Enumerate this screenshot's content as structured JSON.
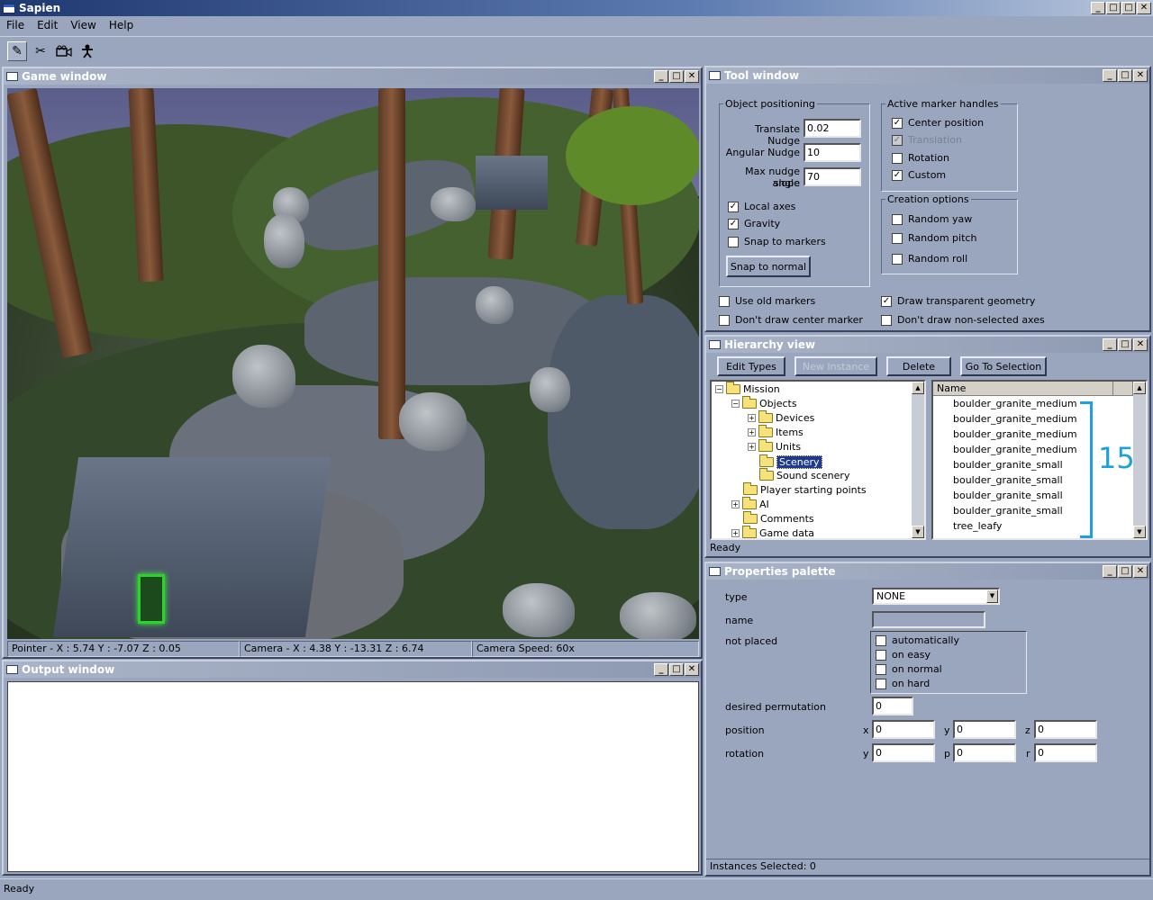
{
  "app": {
    "title": "Sapien"
  },
  "menu": [
    "File",
    "Edit",
    "View",
    "Help"
  ],
  "toolbar": {
    "icons": [
      "pencil-icon",
      "scissors-icon",
      "camera-icon",
      "player-icon"
    ]
  },
  "window_buttons": {
    "minimize": "_",
    "restore": "□",
    "close": "✕"
  },
  "game_window": {
    "title": "Game window",
    "status": {
      "pointer": "Pointer - X : 5.74  Y : -7.07  Z : 0.05",
      "camera": "Camera - X : 4.38  Y : -13.31  Z : 6.74",
      "speed": "Camera Speed: 60x"
    }
  },
  "output_window": {
    "title": "Output window"
  },
  "tool_window": {
    "title": "Tool window",
    "object_positioning": {
      "legend": "Object positioning",
      "translate_label": "Translate Nudge",
      "translate_value": "0.02",
      "angular_label": "Angular Nudge",
      "angular_value": "10",
      "slope_label_1": "Max nudge slope",
      "slope_label_2": "angle",
      "slope_value": "70",
      "local_axes": "Local axes",
      "gravity": "Gravity",
      "snap_markers": "Snap to markers",
      "snap_normal": "Snap to normal"
    },
    "active_marker_handles": {
      "legend": "Active marker handles",
      "center": "Center position",
      "translation": "Translation",
      "rotation": "Rotation",
      "custom": "Custom"
    },
    "creation_options": {
      "legend": "Creation options",
      "yaw": "Random yaw",
      "pitch": "Random pitch",
      "roll": "Random roll"
    },
    "use_old_markers": "Use old markers",
    "dont_draw_center": "Don't draw center marker",
    "draw_transparent": "Draw transparent geometry",
    "dont_draw_axes": "Don't draw non-selected axes"
  },
  "hierarchy": {
    "title": "Hierarchy view",
    "buttons": {
      "edit_types": "Edit Types",
      "new_instance": "New Instance",
      "delete": "Delete",
      "go_to_selection": "Go To Selection"
    },
    "tree": [
      "Mission",
      "Objects",
      "Devices",
      "Items",
      "Units",
      "Scenery",
      "Sound scenery",
      "Player starting points",
      "AI",
      "Comments",
      "Game data"
    ],
    "list_header": "Name",
    "list_items": [
      "boulder_granite_medium",
      "boulder_granite_medium",
      "boulder_granite_medium",
      "boulder_granite_medium",
      "boulder_granite_small",
      "boulder_granite_small",
      "boulder_granite_small",
      "boulder_granite_small",
      "tree_leafy"
    ],
    "annotation": "15",
    "status": "Ready"
  },
  "properties": {
    "title": "Properties palette",
    "type_label": "type",
    "type_value": "NONE",
    "name_label": "name",
    "not_placed_label": "not placed",
    "not_placed_options": [
      "automatically",
      "on easy",
      "on normal",
      "on hard"
    ],
    "desired_perm_label": "desired permutation",
    "desired_perm_value": "0",
    "position_label": "position",
    "position": {
      "x_label": "x",
      "x": "0",
      "y_label": "y",
      "y": "0",
      "z_label": "z",
      "z": "0"
    },
    "rotation_label": "rotation",
    "rotation": {
      "y_label": "y",
      "y": "0",
      "p_label": "p",
      "p": "0",
      "r_label": "r",
      "r": "0"
    },
    "status": "Instances Selected: 0"
  },
  "app_status": "Ready",
  "colors": {
    "annotation": "#1ba0e0",
    "selection": "#1f3a8c",
    "mdi_bg": "#9aa6bd"
  }
}
